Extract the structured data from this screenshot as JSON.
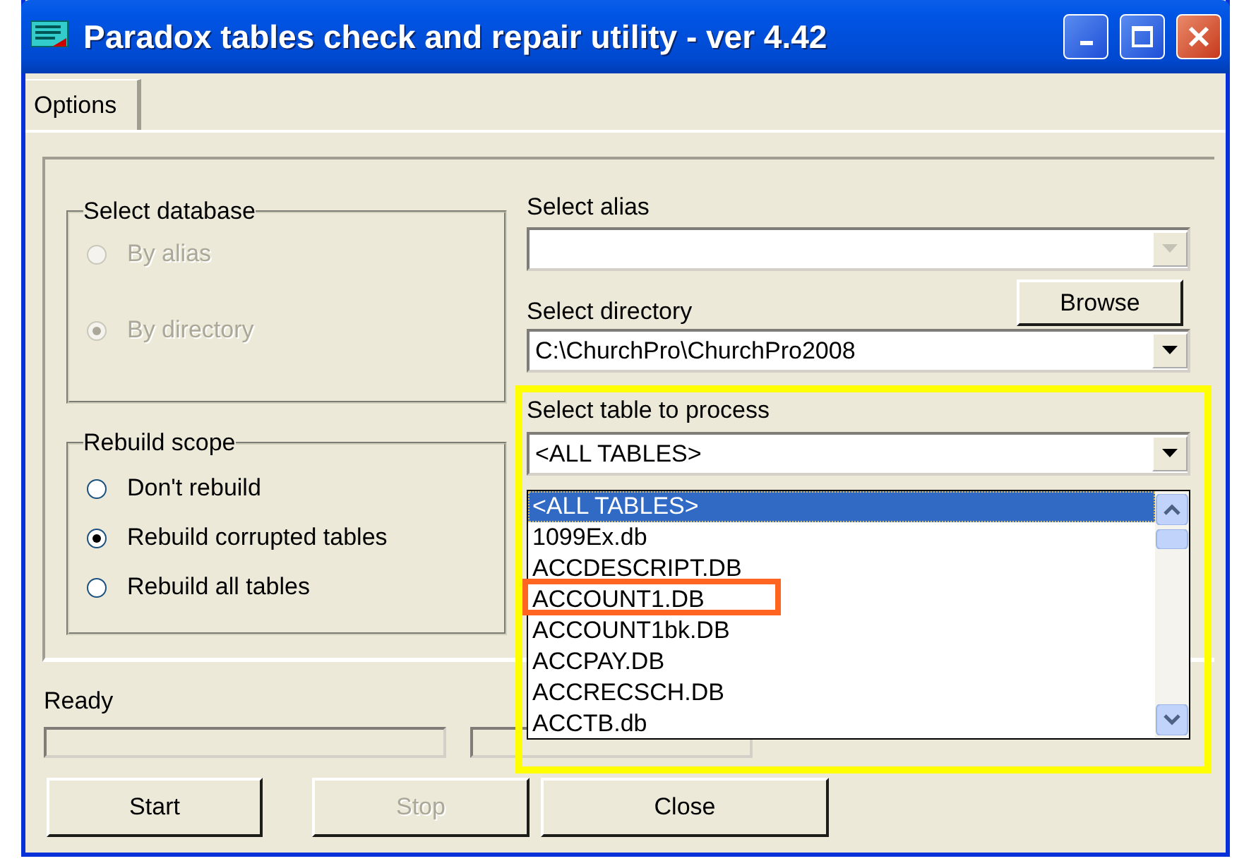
{
  "window": {
    "title": "Paradox tables check and repair utility - ver 4.42"
  },
  "tabs": [
    {
      "label": "Options",
      "selected": true
    }
  ],
  "select_database": {
    "label": "Select database",
    "options": [
      {
        "label": "By alias",
        "selected": false,
        "disabled": true
      },
      {
        "label": "By directory",
        "selected": true,
        "disabled": true
      }
    ]
  },
  "rebuild_scope": {
    "label": "Rebuild scope",
    "options": [
      {
        "label": "Don't rebuild",
        "selected": false,
        "disabled": false
      },
      {
        "label": "Rebuild corrupted tables",
        "selected": true,
        "disabled": false
      },
      {
        "label": "Rebuild all tables",
        "selected": false,
        "disabled": false
      }
    ]
  },
  "alias": {
    "label": "Select alias",
    "disabled": true
  },
  "directory": {
    "label": "Select directory",
    "value": "C:\\ChurchPro\\ChurchPro2008",
    "browse_button": "Browse"
  },
  "table": {
    "label": "Select table to process",
    "value": "<ALL TABLES>",
    "annotated": true,
    "list": [
      {
        "label": "<ALL TABLES>",
        "selected": true,
        "annotated": false
      },
      {
        "label": "1099Ex.db",
        "selected": false,
        "annotated": false
      },
      {
        "label": "ACCDESCRIPT.DB",
        "selected": false,
        "annotated": false
      },
      {
        "label": "ACCOUNT1.DB",
        "selected": false,
        "annotated": true
      },
      {
        "label": "ACCOUNT1bk.DB",
        "selected": false,
        "annotated": false
      },
      {
        "label": "ACCPAY.DB",
        "selected": false,
        "annotated": false
      },
      {
        "label": "ACCRECSCH.DB",
        "selected": false,
        "annotated": false
      },
      {
        "label": "ACCTB.db",
        "selected": false,
        "annotated": false
      }
    ]
  },
  "status": {
    "text": "Ready",
    "progress": [
      {
        "level": 0
      },
      {
        "level": 0
      }
    ]
  },
  "buttons": [
    {
      "label": "Start",
      "disabled": false
    },
    {
      "label": "Stop",
      "disabled": true
    },
    {
      "label": "Close",
      "disabled": false
    }
  ]
}
